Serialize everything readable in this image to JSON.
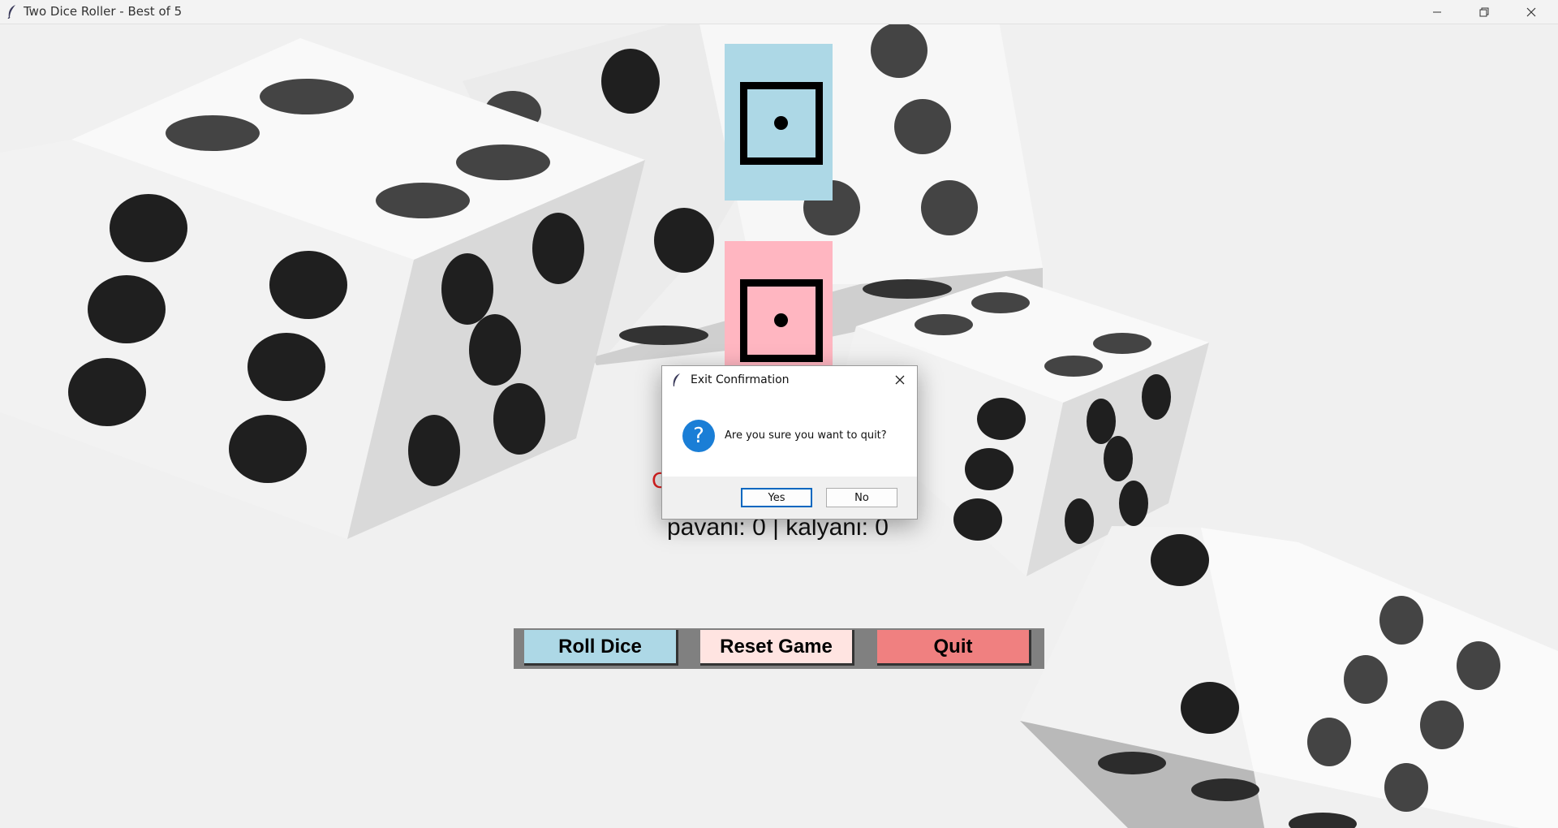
{
  "window": {
    "title": "Two Dice Roller - Best of 5",
    "icon": "feather-icon",
    "controls": {
      "minimize": "minimize-icon",
      "restore": "restore-icon",
      "close": "close-icon"
    }
  },
  "dice": [
    {
      "player": "pavani",
      "value": 1,
      "color": "#add8e6"
    },
    {
      "player": "kalyani",
      "value": 1,
      "color": "#ffb6c1"
    }
  ],
  "message": {
    "text": "C",
    "color": "#e02020"
  },
  "score": {
    "text": "pavani: 0 | kalyani: 0"
  },
  "buttons": {
    "roll": {
      "label": "Roll Dice",
      "color": "#add8e6"
    },
    "reset": {
      "label": "Reset Game",
      "color": "#ffe4e1"
    },
    "quit": {
      "label": "Quit",
      "color": "#f08080"
    }
  },
  "dialog": {
    "title": "Exit Confirmation",
    "icon": "question-icon",
    "message": "Are you sure you want to quit?",
    "yes_label": "Yes",
    "no_label": "No"
  }
}
